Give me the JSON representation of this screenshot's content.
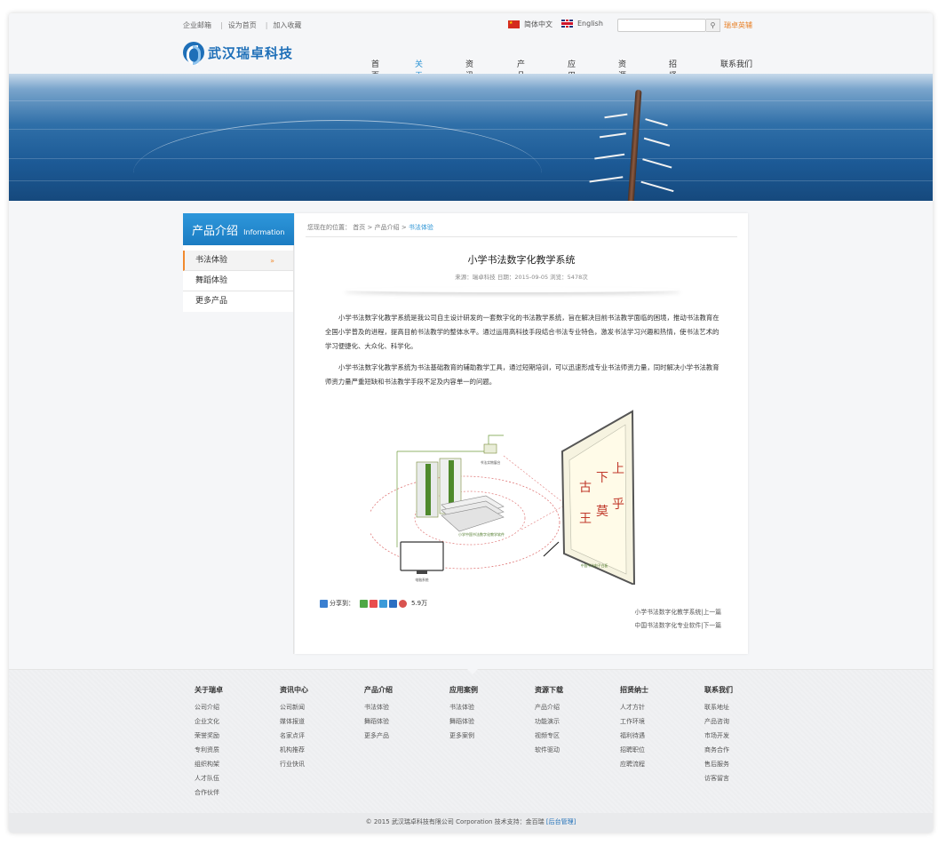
{
  "topbar": {
    "links": [
      "企业邮箱",
      "设为首页",
      "加入收藏"
    ],
    "lang_cn": "简体中文",
    "lang_en": "English",
    "search_placeholder": "",
    "search_icon": "magnifier-icon",
    "hotline": "瑞卓英辅"
  },
  "header": {
    "logo_text": "武汉瑞卓科技",
    "nav": [
      "首页",
      "关于瑞卓",
      "资讯中心",
      "产品介绍",
      "应用案例",
      "资源下载",
      "招贤纳士",
      "联系我们"
    ],
    "nav_active_index": 1
  },
  "sidebar": {
    "title": "产品介绍",
    "subtitle": "Information",
    "items": [
      "书法体验",
      "舞蹈体验",
      "更多产品"
    ],
    "active_marker": "»"
  },
  "breadcrumb": {
    "prefix": "您现在的位置：",
    "items": [
      "首页",
      "产品介绍"
    ],
    "separator": ">",
    "current": "书法体验"
  },
  "article": {
    "title": "小学书法数字化教学系统",
    "meta": "来源：瑞卓科技   日期：2015-09-05   浏览：5478次",
    "paragraphs": [
      "小学书法数字化教学系统是我公司自主设计研发的一套数字化的书法教学系统，旨在解决目前书法教学面临的困境，推动书法教育在全国小学普及的进程，提高目前书法教学的整体水平。通过运用高科技手段结合书法专业特色，激发书法学习兴趣和热情，使书法艺术的学习便捷化、大众化、科学化。",
      "小学书法数字化教学系统为书法基础教育的辅助教学工具，通过短期培训，可以迅速形成专业书法师资力量，同时解决小学书法教育师资力量严重短缺和书法教学手段不足及内容单一的问题。"
    ],
    "figure": {
      "label_camera": "书法实物展台",
      "label_software": "小学中国书法数字化教学软件",
      "label_monitor": "电脑系统",
      "label_board": "中国书法电子白板",
      "board_chars": [
        "古",
        "下",
        "上",
        "王",
        "莫",
        "乎"
      ]
    },
    "share_label": "分享到：",
    "share_count": "5.9万",
    "prev": "小学书法数字化教学系统|上一篇",
    "next": "中国书法数字化专业软件|下一篇"
  },
  "footer": {
    "columns": [
      {
        "title": "关于瑞卓",
        "links": [
          "公司介绍",
          "企业文化",
          "荣誉奖励",
          "专利资质",
          "组织构架",
          "人才队伍",
          "合作伙伴"
        ]
      },
      {
        "title": "资讯中心",
        "links": [
          "公司新闻",
          "媒体报道",
          "名家点评",
          "机构推荐",
          "行业快讯"
        ]
      },
      {
        "title": "产品介绍",
        "links": [
          "书法体验",
          "舞蹈体验",
          "更多产品"
        ]
      },
      {
        "title": "应用案例",
        "links": [
          "书法体验",
          "舞蹈体验",
          "更多案例"
        ]
      },
      {
        "title": "资源下载",
        "links": [
          "产品介绍",
          "功能演示",
          "视频专区",
          "软件驱动"
        ]
      },
      {
        "title": "招贤纳士",
        "links": [
          "人才方针",
          "工作环境",
          "福利待遇",
          "招聘职位",
          "应聘流程"
        ]
      },
      {
        "title": "联系我们",
        "links": [
          "联系地址",
          "产品咨询",
          "市场开发",
          "商务合作",
          "售后服务",
          "访客留言"
        ]
      }
    ],
    "copyright": "© 2015 武汉瑞卓科技有限公司 Corporation 技术支持：金百瑞",
    "admin_link": "[后台管理]"
  },
  "colors": {
    "brand_blue": "#1e6fb8",
    "accent_blue": "#2a93d4",
    "accent_orange": "#f18a2e"
  }
}
